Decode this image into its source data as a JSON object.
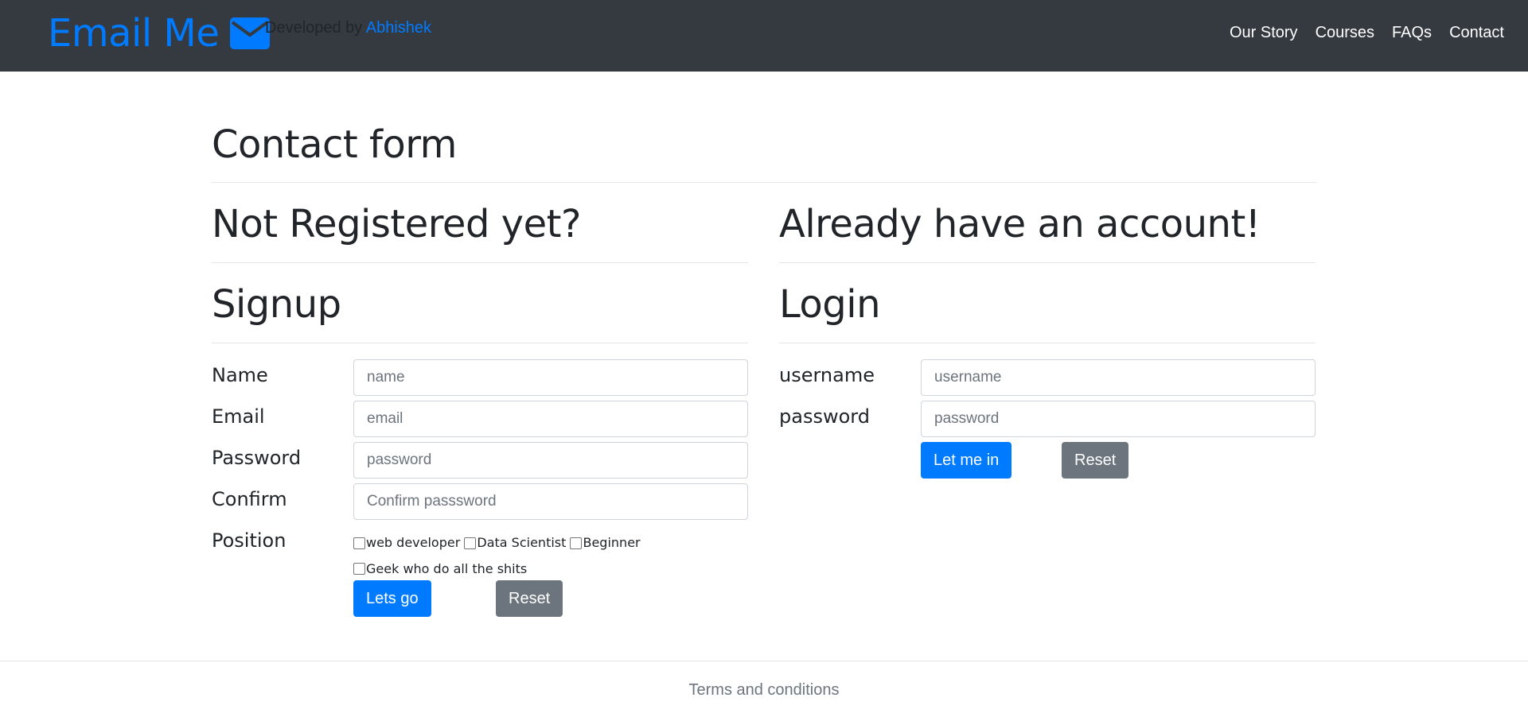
{
  "navbar": {
    "brand": "Email Me",
    "brand_icon": "envelope-icon",
    "dev_prefix": "Developed by ",
    "dev_name": "Abhishek",
    "links": [
      "Our Story",
      "Courses",
      "FAQs",
      "Contact"
    ]
  },
  "main": {
    "title": "Contact form",
    "signup": {
      "question": "Not Registered yet?",
      "heading": "Signup",
      "fields": [
        {
          "label": "Name",
          "placeholder": "name"
        },
        {
          "label": "Email",
          "placeholder": "email"
        },
        {
          "label": "Password",
          "placeholder": "password"
        },
        {
          "label": "Confirm",
          "placeholder": "Confirm passsword"
        }
      ],
      "position_label": "Position",
      "positions": [
        "web developer",
        "Data Scientist",
        "Beginner",
        "Geek who do all the shits"
      ],
      "submit": "Lets go",
      "reset": "Reset"
    },
    "login": {
      "question": "Already have an account!",
      "heading": "Login",
      "fields": [
        {
          "label": "username",
          "placeholder": "username"
        },
        {
          "label": "password",
          "placeholder": "password"
        }
      ],
      "submit": "Let me in",
      "reset": "Reset"
    }
  },
  "footer": {
    "text": "Terms and conditions"
  },
  "colors": {
    "navbar_bg": "#343a40",
    "primary": "#007bff",
    "secondary": "#6c757d"
  }
}
